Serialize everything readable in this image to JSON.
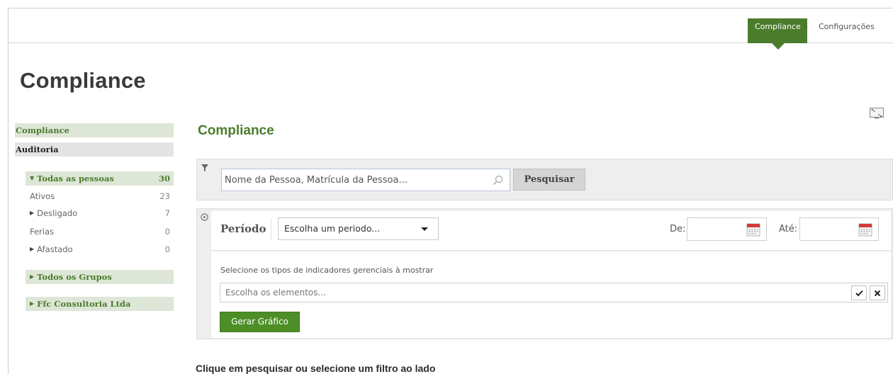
{
  "topbar": {
    "tabs": [
      {
        "label": "Compliance",
        "active": true
      },
      {
        "label": "Configurações",
        "active": false
      }
    ]
  },
  "page": {
    "title": "Compliance"
  },
  "sidebar": {
    "items": [
      {
        "label": "Compliance",
        "active": true
      },
      {
        "label": "Auditoria",
        "active": false
      }
    ],
    "groups": {
      "todas": {
        "label": "Todas as pessoas",
        "count": "30",
        "expanded": true
      },
      "sub": [
        {
          "label": "Ativos",
          "count": "23",
          "has_toggle": false
        },
        {
          "label": "Desligado",
          "count": "7",
          "has_toggle": true
        },
        {
          "label": "Ferias",
          "count": "0",
          "has_toggle": false
        },
        {
          "label": "Afastado",
          "count": "0",
          "has_toggle": true
        }
      ],
      "grupos": {
        "label": "Todos os Grupos",
        "expanded": false
      },
      "empresa": {
        "label": "Ffc Consultoria Ltda",
        "expanded": false
      }
    }
  },
  "main": {
    "title": "Compliance",
    "search": {
      "placeholder": "Nome da Pessoa, Matrícula da Pessoa...",
      "button_label": "Pesquisar"
    },
    "filters": {
      "periodo_label": "Período",
      "period_select": "Escolha um periodo...",
      "de_label": "De:",
      "ate_label": "Até:",
      "indicadores_label": "Selecione os tipos de indicadores gerenciais à mostrar",
      "indicadores_placeholder": "Escolha os elementos...",
      "gerar_label": "Gerar Gráfico"
    },
    "message": "Clique em pesquisar ou selecione um filtro ao lado"
  },
  "colors": {
    "accent_green": "#4b7c2c",
    "button_green": "#4d8f26",
    "sidebar_green_bg": "#dde6d7"
  }
}
